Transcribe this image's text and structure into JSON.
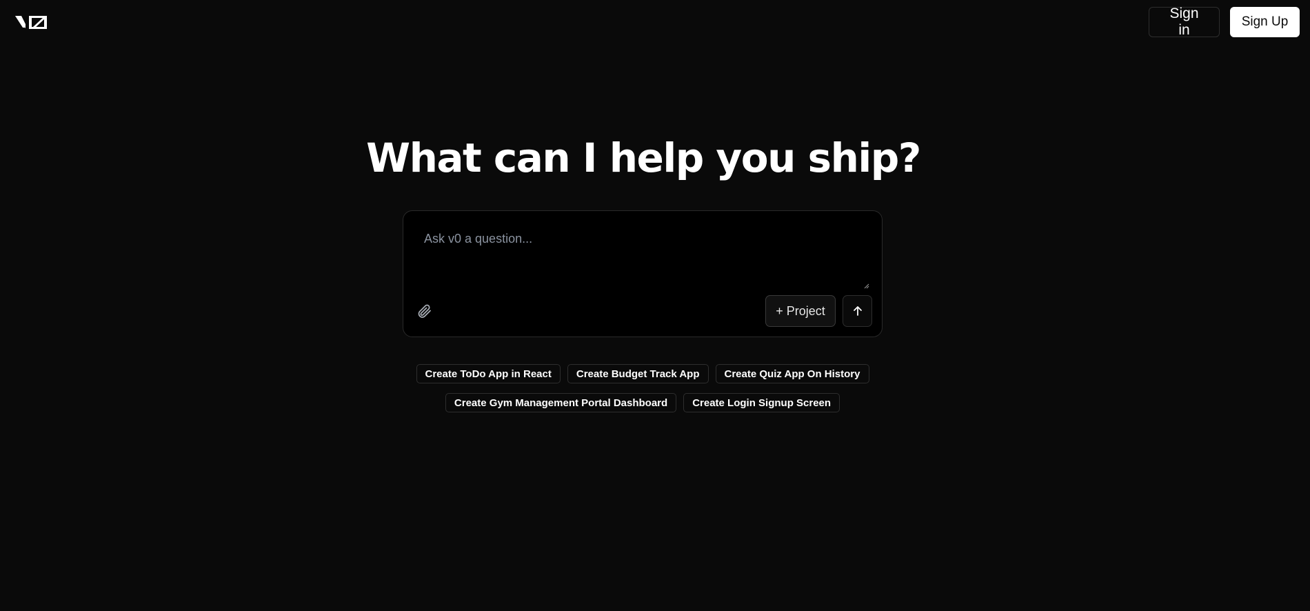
{
  "header": {
    "logo_text": "v0",
    "sign_in_label": "Sign in",
    "sign_up_label": "Sign Up"
  },
  "main": {
    "headline": "What can I help you ship?",
    "prompt": {
      "placeholder": "Ask v0 a question...",
      "value": "",
      "attach_icon": "paperclip-icon",
      "project_label": "+ Project",
      "send_icon": "arrow-up-icon"
    },
    "suggestions": {
      "row1": [
        "Create ToDo App in React",
        "Create Budget Track App",
        "Create Quiz App On History"
      ],
      "row2": [
        "Create Gym Management Portal Dashboard",
        "Create Login Signup Screen"
      ]
    }
  },
  "colors": {
    "background": "#0a0a0a",
    "prompt_background": "#000000",
    "border": "#2e2e2e",
    "text": "#ffffff",
    "placeholder": "#8b93a0"
  }
}
